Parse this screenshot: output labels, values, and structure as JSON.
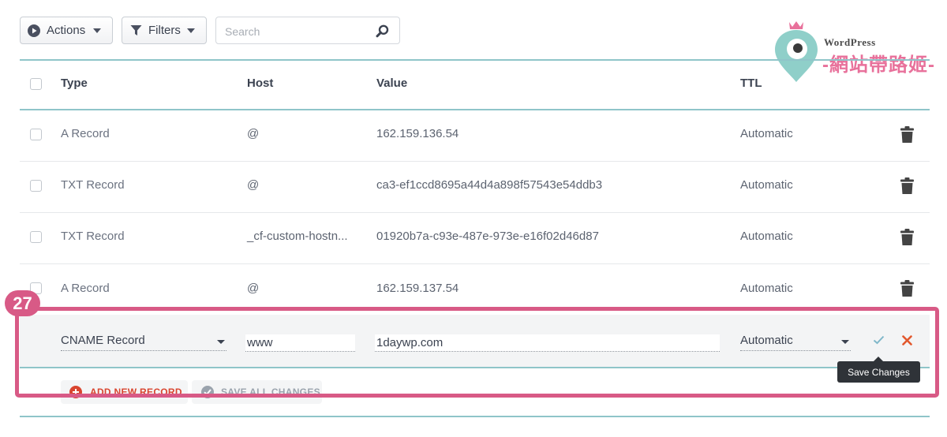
{
  "toolbar": {
    "actions_label": "Actions",
    "filters_label": "Filters",
    "search_placeholder": "Search"
  },
  "logo": {
    "wordpress": "WordPress",
    "site_name": "-網站帶路姬-"
  },
  "table": {
    "headers": {
      "type": "Type",
      "host": "Host",
      "value": "Value",
      "ttl": "TTL"
    },
    "rows": [
      {
        "type": "A Record",
        "host": "@",
        "value": "162.159.136.54",
        "ttl": "Automatic"
      },
      {
        "type": "TXT Record",
        "host": "@",
        "value": "ca3-ef1ccd8695a44d4a898f57543e54ddb3",
        "ttl": "Automatic"
      },
      {
        "type": "TXT Record",
        "host": "_cf-custom-hostn...",
        "value": "01920b7a-c93e-487e-973e-e16f02d46d87",
        "ttl": "Automatic"
      },
      {
        "type": "A Record",
        "host": "@",
        "value": "162.159.137.54",
        "ttl": "Automatic"
      }
    ]
  },
  "edit_row": {
    "type": "CNAME Record",
    "host": "www",
    "value": "1daywp.com",
    "ttl": "Automatic"
  },
  "actions": {
    "add_new_record": "ADD NEW RECORD",
    "save_all_changes": "SAVE ALL CHANGES",
    "tooltip": "Save Changes"
  },
  "annotation": {
    "step_number": "27"
  },
  "colors": {
    "accent_rule": "#8fc5c9",
    "highlight_frame": "#d85a86",
    "add_red": "#d9452f",
    "save_gray": "#9aa3ad",
    "confirm_teal": "#7fb7c9",
    "cancel_orange": "#e2582d"
  }
}
